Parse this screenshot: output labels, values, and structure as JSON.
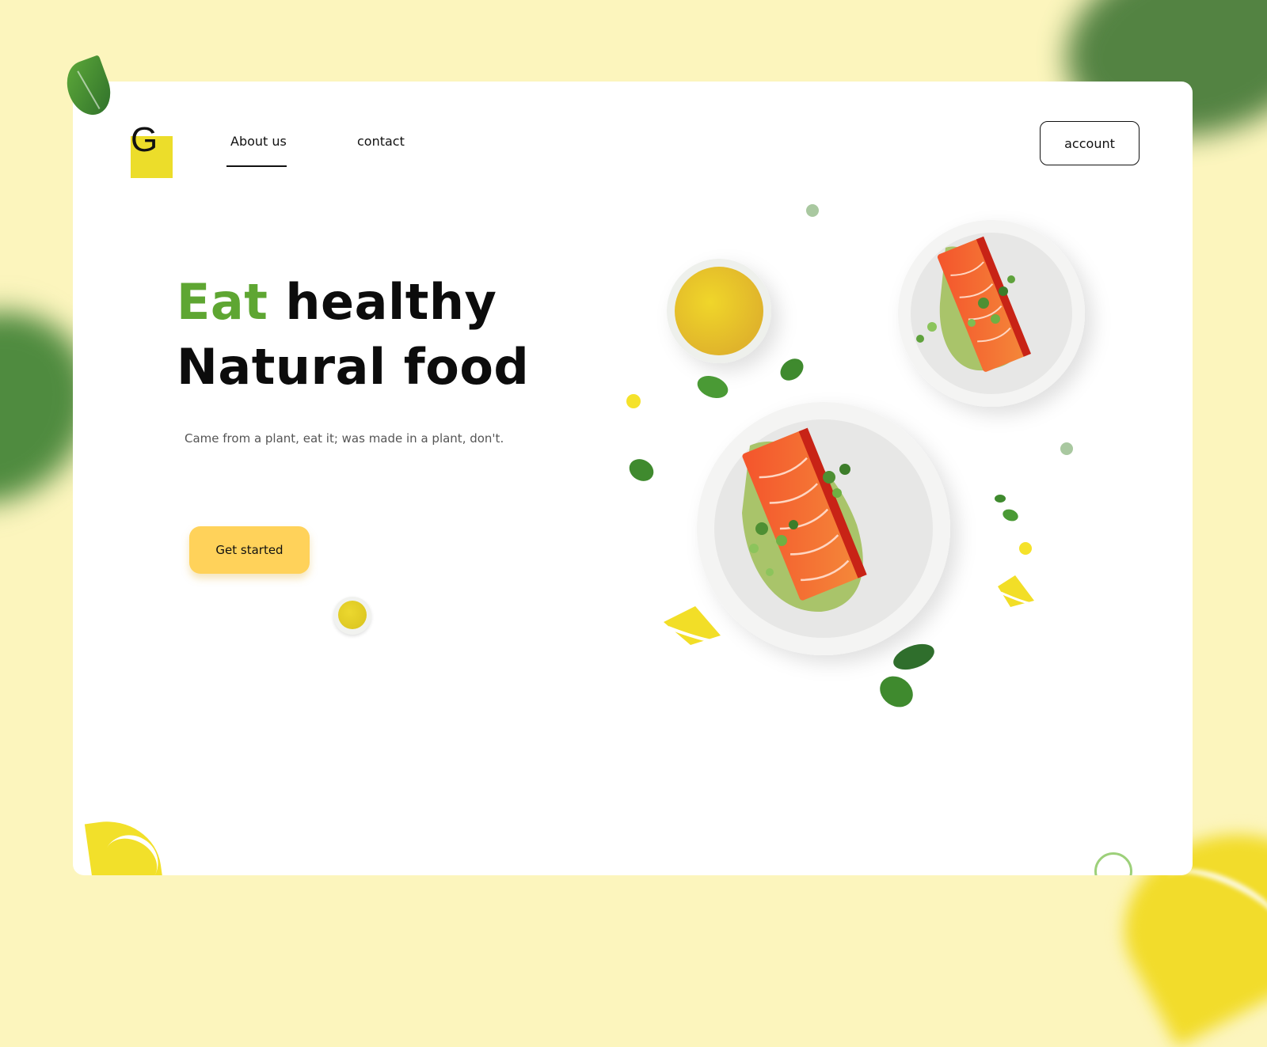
{
  "brand": {
    "logo_letter": "G",
    "accent_color": "#ecdd2a"
  },
  "nav": {
    "items": [
      {
        "label": "About us",
        "active": true
      },
      {
        "label": "contact",
        "active": false
      }
    ]
  },
  "header": {
    "account_label": "account"
  },
  "hero": {
    "title_accent": "Eat",
    "title_rest_line1": " healthy",
    "title_line2": "Natural food",
    "subtitle": "Came from a plant, eat it; was made in a plant, don't.",
    "cta_label": "Get started"
  },
  "colors": {
    "background": "#fcf5bd",
    "accent_green": "#5ea632",
    "cta_yellow": "#ffd25a",
    "salmon": "#f2673a",
    "leaf_green": "#3f8a2e"
  },
  "icons": {
    "leaf": "leaf-icon",
    "lemon": "lemon-slice-icon",
    "plate": "salmon-plate-icon",
    "bowl": "sauce-bowl-icon"
  }
}
